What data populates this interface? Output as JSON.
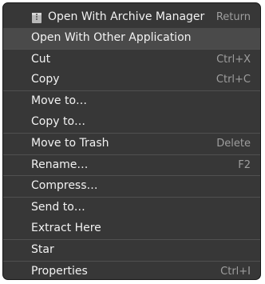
{
  "menu": {
    "items": [
      {
        "label": "Open With Archive Manager",
        "accel": "Return",
        "icon": "archive-manager-icon"
      },
      {
        "label": "Open With Other Application",
        "accel": ""
      },
      {
        "label": "Cut",
        "accel": "Ctrl+X"
      },
      {
        "label": "Copy",
        "accel": "Ctrl+C"
      },
      {
        "label": "Move to…",
        "accel": ""
      },
      {
        "label": "Copy to…",
        "accel": ""
      },
      {
        "label": "Move to Trash",
        "accel": "Delete"
      },
      {
        "label": "Rename…",
        "accel": "F2"
      },
      {
        "label": "Compress…",
        "accel": ""
      },
      {
        "label": "Send to…",
        "accel": ""
      },
      {
        "label": "Extract Here",
        "accel": ""
      },
      {
        "label": "Star",
        "accel": ""
      },
      {
        "label": "Properties",
        "accel": "Ctrl+I"
      }
    ]
  }
}
